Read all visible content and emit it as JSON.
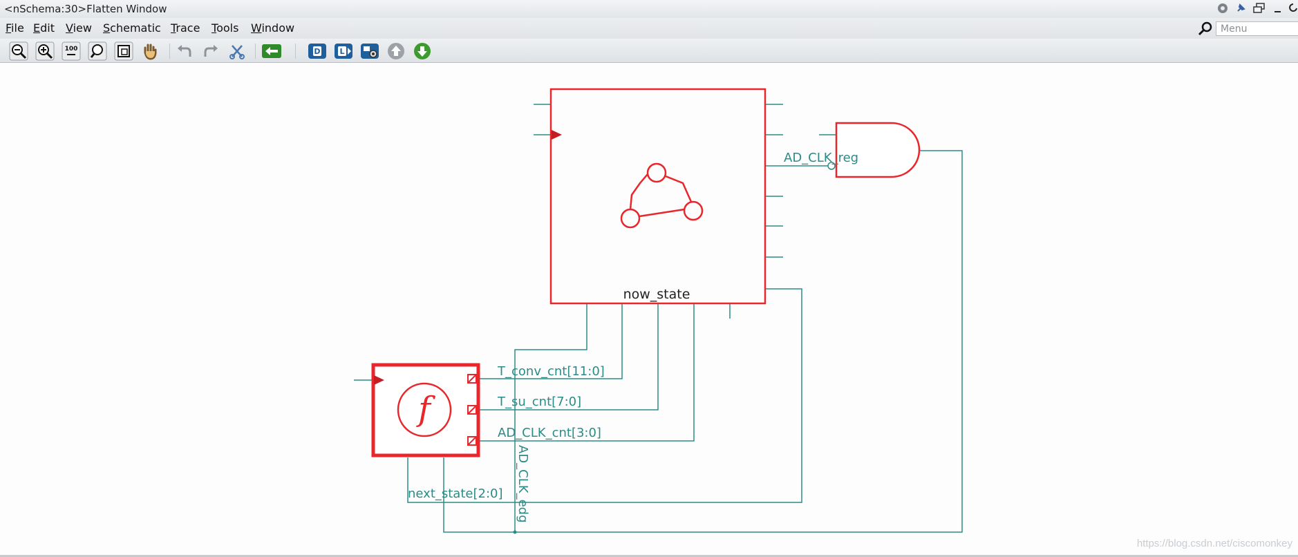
{
  "window": {
    "title": "<nSchema:30>Flatten Window",
    "controls": [
      "gear-icon",
      "pin-icon",
      "restore-icon",
      "minimize-icon",
      "close-icon"
    ]
  },
  "menubar": {
    "items": [
      "File",
      "Edit",
      "View",
      "Schematic",
      "Trace",
      "Tools",
      "Window"
    ],
    "search_placeholder": "Menu"
  },
  "toolbar": {
    "buttons": [
      "zoom-out-icon",
      "zoom-in-icon",
      "zoom-100-icon",
      "zoom-fit-icon",
      "zoom-area-icon",
      "pan-hand-icon",
      "undo-icon",
      "redo-icon",
      "cut-icon",
      "back-arrow-icon",
      "driver-d-icon",
      "load-l-icon",
      "trace-icon",
      "up-icon",
      "down-icon"
    ]
  },
  "schematic": {
    "instances": {
      "fsm_block": "now_state",
      "and_gate": "AD_CLK_reg",
      "function_block": "f"
    },
    "nets": {
      "t_conv": "T_conv_cnt[11:0]",
      "t_su": "T_su_cnt[7:0]",
      "ad_clk_cnt": "AD_CLK_cnt[3:0]",
      "next_state": "next_state[2:0]",
      "ad_clk_edg": "AD_CLK_edg"
    },
    "colors": {
      "instance": "#e8262b",
      "net": "#2b8b86",
      "port": "#5aa8a4"
    }
  },
  "watermark": "https://blog.csdn.net/ciscomonkey"
}
